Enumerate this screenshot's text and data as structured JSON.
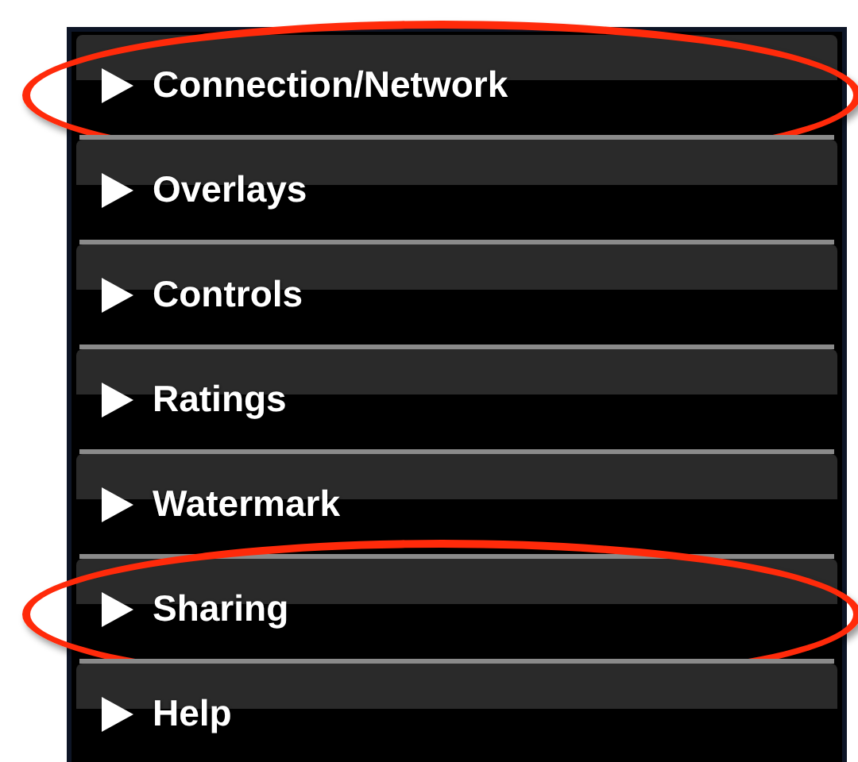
{
  "menu": {
    "items": [
      {
        "label": "Connection/Network",
        "circled": true
      },
      {
        "label": "Overlays",
        "circled": false
      },
      {
        "label": "Controls",
        "circled": false
      },
      {
        "label": "Ratings",
        "circled": false
      },
      {
        "label": "Watermark",
        "circled": false
      },
      {
        "label": "Sharing",
        "circled": true
      },
      {
        "label": "Help",
        "circled": false
      }
    ]
  }
}
